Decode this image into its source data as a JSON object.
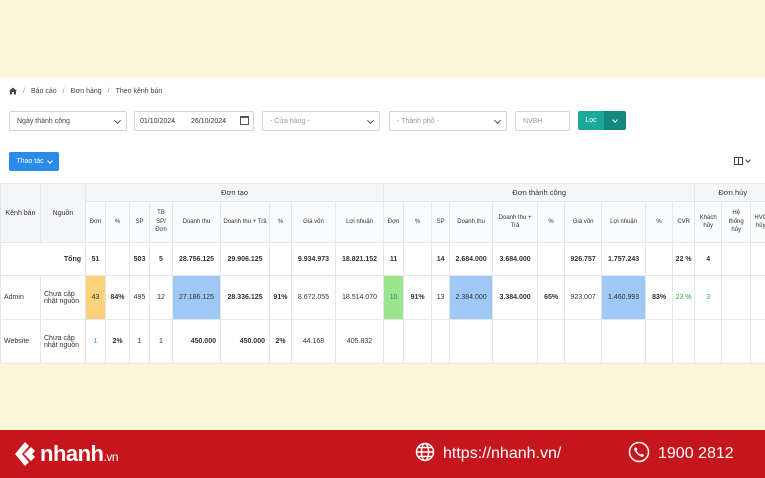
{
  "breadcrumb": {
    "items": [
      "Báo cáo",
      "Đơn hàng",
      "Theo kênh bán"
    ]
  },
  "filters": {
    "date_type": "Ngày thành công",
    "date_from": "01/10/2024",
    "date_to": "26/10/2024",
    "store_placeholder": "- Cửa hàng -",
    "city_placeholder": "- Thành phố -",
    "staff_placeholder": "NVBH",
    "filter_label": "Lọc"
  },
  "actions": {
    "label": "Thao tác"
  },
  "table": {
    "group_headers": {
      "channel": "Kênh bán",
      "source": "Nguồn",
      "created": "Đơn tạo",
      "success": "Đơn thành công",
      "cancel": "Đơn hủy"
    },
    "created_cols": [
      "Đơn",
      "%",
      "SP",
      "TB SP/ Đơn",
      "Doanh thu",
      "Doanh thu + Trả",
      "%",
      "Giá vốn",
      "Lợi nhuận"
    ],
    "success_cols": [
      "Đơn",
      "%",
      "SP",
      "Doanh thu",
      "Doanh thu + Trả",
      "%",
      "Giá vốn",
      "Lợi nhuận",
      "%",
      "CVR"
    ],
    "cancel_cols": [
      "Khách hủy",
      "Hệ thống hủy",
      "HVC hủy"
    ],
    "total": {
      "label": "Tổng",
      "created": [
        "51",
        "",
        "503",
        "5",
        "28.756.125",
        "29.906.125",
        "",
        "9.934.973",
        "18.821.152"
      ],
      "success": [
        "11",
        "",
        "14",
        "2.684.000",
        "3.684.000",
        "",
        "926.757",
        "1.757.243",
        "",
        "22 %"
      ],
      "cancel": [
        "4",
        "",
        ""
      ]
    },
    "rows": [
      {
        "channel": "Admin",
        "source": "Chưa cập nhật nguồn",
        "created": [
          "43",
          "84%",
          "495",
          "12",
          "27.186.125",
          "28.336.125",
          "91%",
          "8.672.055",
          "18.514.070"
        ],
        "success": [
          "10",
          "91%",
          "13",
          "2.384.000",
          "3.384.000",
          "65%",
          "923.007",
          "1.460.993",
          "83%",
          "23 %"
        ],
        "cancel": [
          "3",
          "",
          ""
        ]
      },
      {
        "channel": "Website",
        "source": "Chưa cập nhật nguồn",
        "created": [
          "1",
          "2%",
          "1",
          "1",
          "450.000",
          "450.000",
          "2%",
          "44.168",
          "405.832"
        ],
        "success": [
          "",
          "",
          "",
          "",
          "",
          "",
          "",
          "",
          "",
          ""
        ],
        "cancel": [
          "",
          "",
          ""
        ]
      }
    ]
  },
  "footer": {
    "brand": "nhanh",
    "brand_tld": ".vn",
    "website": "https://nhanh.vn/",
    "hotline": "1900 2812"
  },
  "colors": {
    "accent": "#1aa89a",
    "action": "#2b8be8",
    "footer": "#c4161c"
  }
}
